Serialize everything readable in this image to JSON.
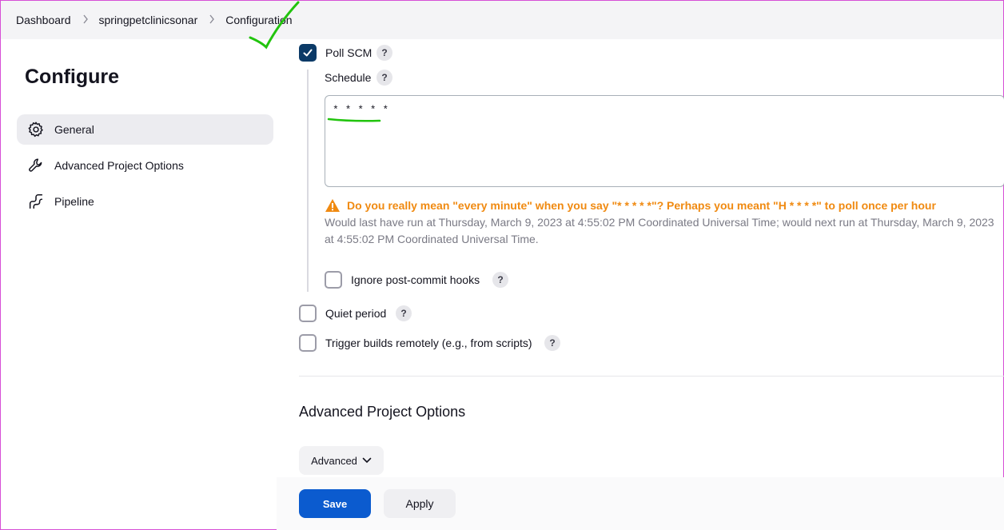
{
  "breadcrumb": {
    "items": [
      "Dashboard",
      "springpetclinicsonar",
      "Configuration"
    ],
    "separator": ">"
  },
  "sidebar": {
    "title": "Configure",
    "items": [
      {
        "label": "General",
        "icon": "gear-icon",
        "active": true
      },
      {
        "label": "Advanced Project Options",
        "icon": "wrench-icon",
        "active": false
      },
      {
        "label": "Pipeline",
        "icon": "pipeline-icon",
        "active": false
      }
    ]
  },
  "triggers": {
    "poll_scm": {
      "label": "Poll SCM",
      "checked": true,
      "help": "?"
    },
    "schedule": {
      "label": "Schedule",
      "help": "?",
      "value": "* * * * *"
    },
    "warning": "Do you really mean \"every minute\" when you say \"* * * * *\"? Perhaps you meant \"H * * * *\" to poll once per hour",
    "info": "Would last have run at Thursday, March 9, 2023 at 4:55:02 PM Coordinated Universal Time; would next run at Thursday, March 9, 2023 at 4:55:02 PM Coordinated Universal Time.",
    "ignore_hooks": {
      "label": "Ignore post-commit hooks",
      "checked": false,
      "help": "?"
    },
    "quiet_period": {
      "label": "Quiet period",
      "checked": false,
      "help": "?"
    },
    "trigger_remote": {
      "label": "Trigger builds remotely (e.g., from scripts)",
      "checked": false,
      "help": "?"
    }
  },
  "advanced_section": {
    "title": "Advanced Project Options",
    "button_label": "Advanced"
  },
  "actions": {
    "save_label": "Save",
    "apply_label": "Apply"
  },
  "colors": {
    "accent": "#0b5bcf",
    "checkbox": "#0b3a67",
    "warning": "#f08a11",
    "annotation": "#22c40e"
  }
}
